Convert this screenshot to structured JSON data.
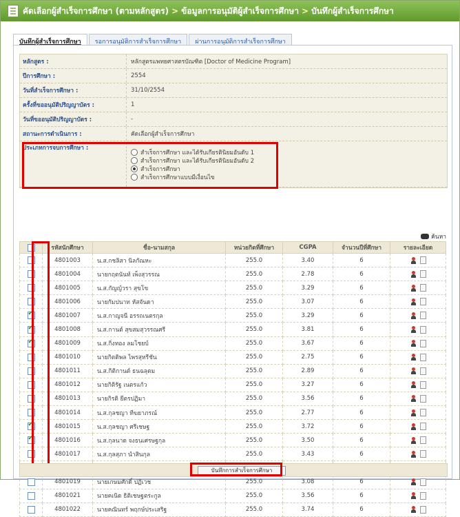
{
  "header": {
    "crumbs": [
      "คัดเลือกผู้สำเร็จการศึกษา (ตามหลักสูตร)",
      "ข้อมูลการอนุมัติผู้สำเร็จการศึกษา",
      "บันทึกผู้สำเร็จการศึกษา"
    ],
    "separator": ">"
  },
  "tabs": [
    "บันทึกผู้สำเร็จการศึกษา",
    "รอการอนุมัติการสำเร็จการศึกษา",
    "ผ่านการอนุมัติการสำเร็จการศึกษา"
  ],
  "info": {
    "rows": [
      {
        "label": "หลักสูตร :",
        "value": "หลักสูตรแพทยศาสตรบัณฑิต [Doctor of Medicine Program]"
      },
      {
        "label": "ปีการศึกษา :",
        "value": "2554"
      },
      {
        "label": "วันที่สำเร็จการศึกษา :",
        "value": "31/10/2554"
      },
      {
        "label": "ครั้งที่ขออนุมัติปริญญาบัตร :",
        "value": "1"
      },
      {
        "label": "วันที่ขออนุมัติปริญญาบัตร :",
        "value": "-"
      },
      {
        "label": "สถานะการดำเนินการ :",
        "value": "คัดเลือกผู้สำเร็จการศึกษา"
      }
    ],
    "graduation_label": "ประเภทการจบการศึกษา :",
    "graduation_options": [
      "สำเร็จการศึกษา และได้รับเกียรตินิยมอันดับ 1",
      "สำเร็จการศึกษา และได้รับเกียรตินิยมอันดับ 2",
      "สำเร็จการศึกษา",
      "สำเร็จการศึกษาแบบมีเงื่อนไข"
    ],
    "graduation_selected": 2
  },
  "search_label": "ค้นหา",
  "table": {
    "headers": [
      "",
      "รหัสนักศึกษา",
      "ชื่อ-นามสกุล",
      "หน่วยกิตที่ศึกษา",
      "CGPA",
      "จำนวนปีที่ศึกษา",
      "รายละเอียด"
    ],
    "rows": [
      {
        "id": "4801003",
        "name": "น.ส.กชลิสา นิลกัณหะ",
        "credits": "255.0",
        "cgpa": "3.40",
        "years": "6",
        "checked": false
      },
      {
        "id": "4801004",
        "name": "นายกฤตนันท์ เพ็งสุวรรณ",
        "credits": "255.0",
        "cgpa": "2.78",
        "years": "6",
        "checked": false
      },
      {
        "id": "4801005",
        "name": "น.ส.กัญญ์วรา สุขโข",
        "credits": "255.0",
        "cgpa": "3.29",
        "years": "6",
        "checked": false
      },
      {
        "id": "4801006",
        "name": "นายกัมปนาท หัสจันดา",
        "credits": "255.0",
        "cgpa": "3.07",
        "years": "6",
        "checked": false
      },
      {
        "id": "4801007",
        "name": "น.ส.กาญจนี อรรถเนตรกุล",
        "credits": "255.0",
        "cgpa": "3.29",
        "years": "6",
        "checked": true
      },
      {
        "id": "4801008",
        "name": "น.ส.กานต์ สุขสมสุวรรณศรี",
        "credits": "255.0",
        "cgpa": "3.81",
        "years": "6",
        "checked": true
      },
      {
        "id": "4801009",
        "name": "น.ส.กิ่งทอง ลมโชยบ์",
        "credits": "255.0",
        "cgpa": "3.67",
        "years": "6",
        "checked": true
      },
      {
        "id": "4801010",
        "name": "นายกิตติพล ไพรสุหรีชัน",
        "credits": "255.0",
        "cgpa": "2.75",
        "years": "6",
        "checked": false
      },
      {
        "id": "4801011",
        "name": "น.ส.กิติกานต์ ธนฉลุตม",
        "credits": "255.0",
        "cgpa": "2.89",
        "years": "6",
        "checked": false
      },
      {
        "id": "4801012",
        "name": "นายกิติรัฐ เนตรแก้ว",
        "credits": "255.0",
        "cgpa": "3.27",
        "years": "6",
        "checked": false
      },
      {
        "id": "4801013",
        "name": "นายกิรติ ยีตรปฏิมา",
        "credits": "255.0",
        "cgpa": "3.56",
        "years": "6",
        "checked": false
      },
      {
        "id": "4801014",
        "name": "น.ส.กุลชญา ทีฆยาภรณ์",
        "credits": "255.0",
        "cgpa": "2.77",
        "years": "6",
        "checked": false
      },
      {
        "id": "4801015",
        "name": "น.ส.กุลชญา ศรีเชษฐ",
        "credits": "255.0",
        "cgpa": "3.72",
        "years": "6",
        "checked": true
      },
      {
        "id": "4801016",
        "name": "น.ส.กุลนาด จงธนเศรษฐกุล",
        "credits": "255.0",
        "cgpa": "3.50",
        "years": "6",
        "checked": true
      },
      {
        "id": "4801017",
        "name": "น.ส.กุลสุภา นำสินกุล",
        "credits": "255.0",
        "cgpa": "3.43",
        "years": "6",
        "checked": false
      },
      {
        "id": "4801018",
        "name": "นายเกริกวิชช์ วิสิฐสกุลชัย",
        "credits": "255.0",
        "cgpa": "3.25",
        "years": "6",
        "checked": false
      },
      {
        "id": "4801019",
        "name": "นายเกษมศักดิ์ ปฏิเวช",
        "credits": "255.0",
        "cgpa": "3.08",
        "years": "6",
        "checked": false
      },
      {
        "id": "4801021",
        "name": "นายคเนิด ธิติเชษฐตระกูล",
        "credits": "255.0",
        "cgpa": "3.56",
        "years": "6",
        "checked": false
      },
      {
        "id": "4801022",
        "name": "นายคณินทร์ พฤกษ์ประเสริฐ",
        "credits": "255.0",
        "cgpa": "3.74",
        "years": "6",
        "checked": false
      }
    ]
  },
  "save_button": "บันทึกการสำเร็จการศึกษา"
}
